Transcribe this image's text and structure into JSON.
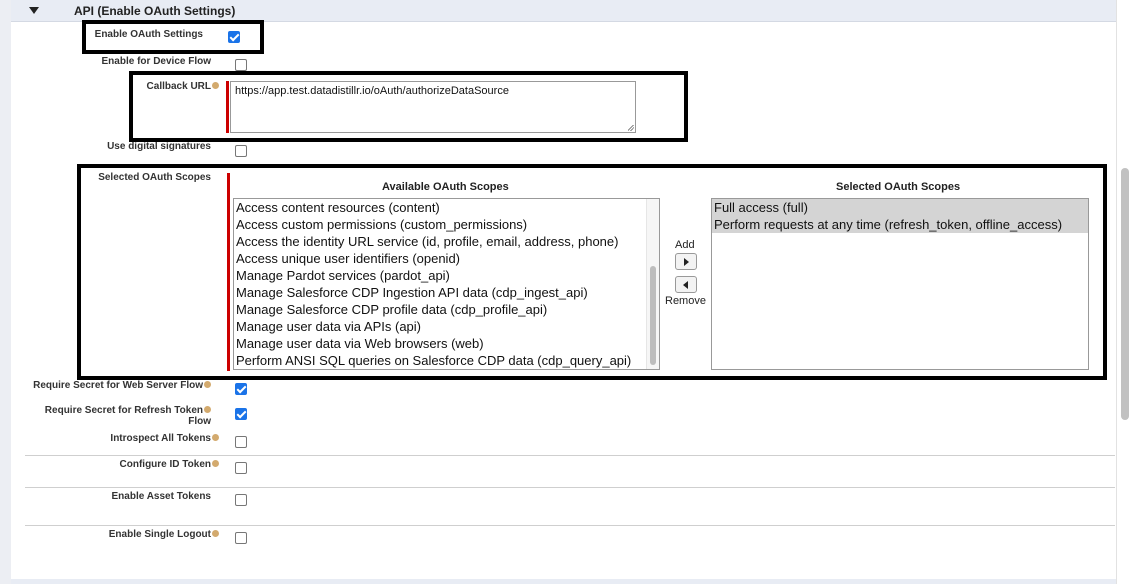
{
  "section": {
    "title": "API (Enable OAuth Settings)"
  },
  "fields": {
    "enable_oauth": {
      "label": "Enable OAuth Settings",
      "checked": true
    },
    "device_flow": {
      "label": "Enable for Device Flow",
      "checked": false
    },
    "callback_url": {
      "label": "Callback URL",
      "value": "https://app.test.datadistillr.io/oAuth/authorizeDataSource"
    },
    "digital_signatures": {
      "label": "Use digital signatures",
      "checked": false
    },
    "scopes": {
      "label": "Selected OAuth Scopes",
      "available_header": "Available OAuth Scopes",
      "selected_header": "Selected OAuth Scopes",
      "available": [
        "Access content resources (content)",
        "Access custom permissions (custom_permissions)",
        "Access the identity URL service (id, profile, email, address, phone)",
        "Access unique user identifiers (openid)",
        "Manage Pardot services (pardot_api)",
        "Manage Salesforce CDP Ingestion API data (cdp_ingest_api)",
        "Manage Salesforce CDP profile data (cdp_profile_api)",
        "Manage user data via APIs (api)",
        "Manage user data via Web browsers (web)",
        "Perform ANSI SQL queries on Salesforce CDP data (cdp_query_api)"
      ],
      "selected": [
        "Full access (full)",
        "Perform requests at any time (refresh_token, offline_access)"
      ],
      "add_label": "Add",
      "remove_label": "Remove"
    },
    "secret_web_server": {
      "label": "Require Secret for Web Server Flow",
      "checked": true
    },
    "secret_refresh_line1": "Require Secret for Refresh Token",
    "secret_refresh_line2": "Flow",
    "secret_refresh_checked": true,
    "introspect": {
      "label": "Introspect All Tokens",
      "checked": false
    },
    "id_token": {
      "label": "Configure ID Token",
      "checked": false
    },
    "asset_tokens": {
      "label": "Enable Asset Tokens",
      "checked": false
    },
    "single_logout": {
      "label": "Enable Single Logout",
      "checked": false
    }
  }
}
